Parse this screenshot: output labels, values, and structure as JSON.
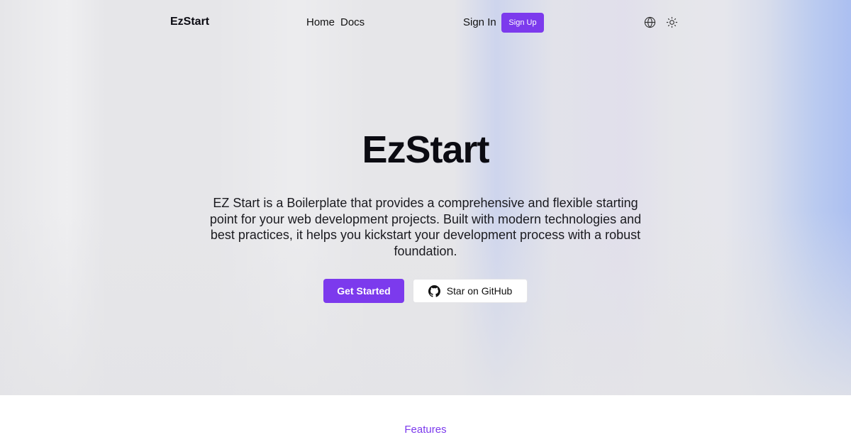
{
  "nav": {
    "brand": "EzStart",
    "links": [
      "Home",
      "Docs"
    ],
    "sign_in": "Sign In",
    "sign_up": "Sign Up",
    "icons": [
      "globe-icon",
      "sun-icon"
    ]
  },
  "hero": {
    "title": "EzStart",
    "description": "EZ Start is a Boilerplate that provides a comprehensive and flexible starting point for your web development projects. Built with modern technologies and best practices, it helps you kickstart your development process with a robust foundation.",
    "primary_cta": "Get Started",
    "secondary_cta": "Star on GitHub",
    "secondary_icon": "github-icon"
  },
  "section": {
    "eyebrow": "Features"
  },
  "colors": {
    "accent": "#7c3aed",
    "hero_bg": "#e6e6e9",
    "text": "#0b0b12"
  }
}
